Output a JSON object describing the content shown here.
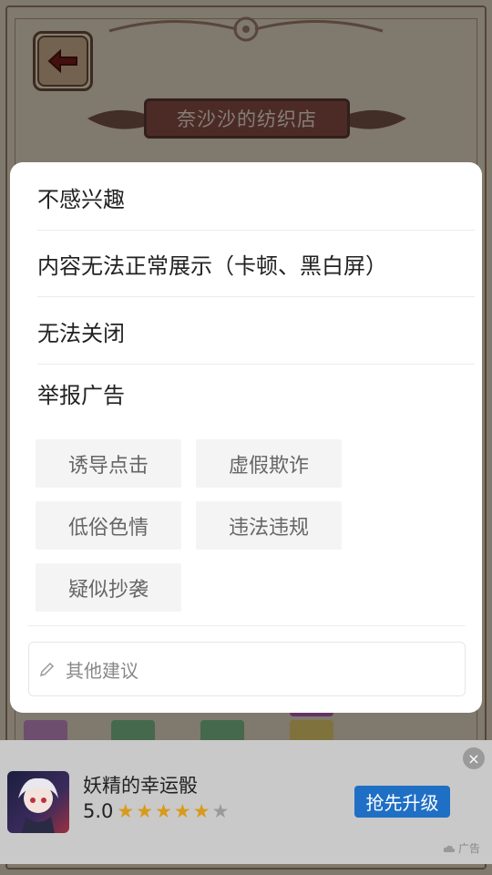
{
  "background": {
    "shop_title": "奈沙沙的纺织店"
  },
  "dialog": {
    "options": [
      {
        "label": "不感兴趣"
      },
      {
        "label": "内容无法正常展示（卡顿、黑白屏）"
      },
      {
        "label": "无法关闭"
      }
    ],
    "report_title": "举报广告",
    "report_reasons": [
      "诱导点击",
      "虚假欺诈",
      "低俗色情",
      "违法违规",
      "疑似抄袭"
    ],
    "suggestion_placeholder": "其他建议"
  },
  "ad": {
    "app_name": "妖精的幸运骰",
    "rating": "5.0",
    "stars_filled": 5,
    "stars_total": 6,
    "cta_label": "抢先升级",
    "ad_label": "广告",
    "close_symbol": "×",
    "colors": {
      "cta": "#1f6fc5",
      "star": "#d99a1a"
    }
  }
}
